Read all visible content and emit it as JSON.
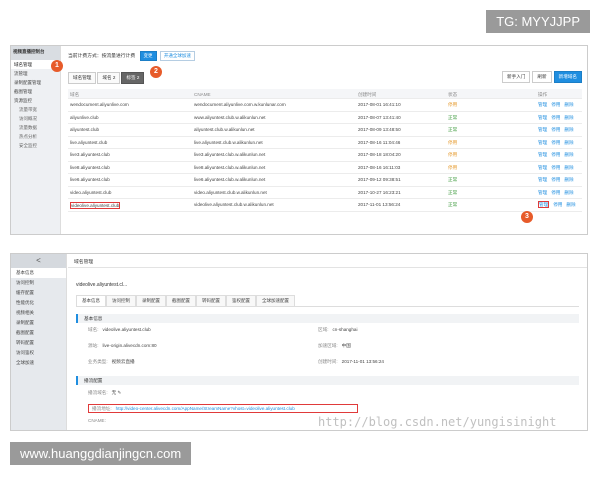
{
  "watermarks": {
    "top": "TG: MYYJJPP",
    "bottom": "www.huanggdianjingcn.com",
    "diagonal": "http://blog.csdn.net/yungisinight"
  },
  "panel1": {
    "sidebar": {
      "title": "视频直播控制台",
      "items": [
        "域名管理",
        "流管理",
        "录制配置管理",
        "截图管理",
        "资源监控",
        "流量带宽",
        "访问概况",
        "流量数据",
        "热点分析",
        "安全监控"
      ]
    },
    "notice": {
      "text": "当前计费方式：按流量进行计费",
      "change_label": "变更",
      "activate_label": "开通全球加速"
    },
    "tabs": [
      "域名管理",
      "域名 2",
      "标签 2"
    ],
    "actions": {
      "guide": "新手入门",
      "refresh": "刷新",
      "add": "新增域名"
    },
    "columns": [
      "域名",
      "CNAME",
      "创建时间",
      "状态",
      "操作"
    ],
    "rows": [
      {
        "domain": "wendocument.aliyunlive.com",
        "cname": "wendocument.aliyunlive.com.w.kunlunar.com",
        "created": "2017-08-01 16:41:10",
        "status": "停用",
        "status_type": "warn",
        "ops": [
          "管理",
          "停用",
          "删除"
        ]
      },
      {
        "domain": "aliyunlive.club",
        "cname": "www.aliyuntest.club.w.alikunlun.net",
        "created": "2017-08-07 13:41:40",
        "status": "正常",
        "status_type": "ok",
        "ops": [
          "管理",
          "停用",
          "删除"
        ]
      },
      {
        "domain": "aliyuntest.club",
        "cname": "aliyuntest.club.w.alikunlun.net",
        "created": "2017-08-09 13:48:50",
        "status": "正常",
        "status_type": "ok",
        "ops": [
          "管理",
          "停用",
          "删除"
        ]
      },
      {
        "domain": "live.aliyuntest.club",
        "cname": "live.aliyuntest.club.w.alikunlun.net",
        "created": "2017-08-16 11:04:46",
        "status": "停用",
        "status_type": "warn",
        "ops": [
          "管理",
          "停用",
          "删除"
        ]
      },
      {
        "domain": "live3.aliyuntest.club",
        "cname": "live3.aliyuntest.club.w.alikunlun.net",
        "created": "2017-08-18 18:04:20",
        "status": "停用",
        "status_type": "warn",
        "ops": [
          "管理",
          "停用",
          "删除"
        ]
      },
      {
        "domain": "live8.aliyuntest.club",
        "cname": "live8.aliyuntest.club.w.alikunlun.net",
        "created": "2017-08-16 16:11:03",
        "status": "停用",
        "status_type": "warn",
        "ops": [
          "管理",
          "停用",
          "删除"
        ]
      },
      {
        "domain": "live6.aliyuntest.club",
        "cname": "live6.aliyuntest.club.w.alikunlun.net",
        "created": "2017-09-12 09:38:51",
        "status": "正常",
        "status_type": "ok",
        "ops": [
          "管理",
          "停用",
          "删除"
        ]
      },
      {
        "domain": "video.aliyuntest.club",
        "cname": "video.aliyuntest.club.w.alikunlun.net",
        "created": "2017-10-27 16:23:21",
        "status": "正常",
        "status_type": "ok",
        "ops": [
          "管理",
          "停用",
          "删除"
        ]
      },
      {
        "domain": "videolive.aliyuntest.club",
        "cname": "videolive.aliyuntest.club.w.alikunlun.net",
        "created": "2017-11-01 13:56:24",
        "status": "正常",
        "status_type": "ok",
        "ops": [
          "管理",
          "停用",
          "删除"
        ]
      }
    ],
    "markers": [
      "1",
      "2",
      "3"
    ]
  },
  "panel2": {
    "sidebar": {
      "back": "<",
      "items": [
        "基本信息",
        "访问控制",
        "缓存配置",
        "性能优化",
        "视频相关",
        "录制配置",
        "截图配置",
        "转码配置",
        "访问鉴权",
        "全球加速"
      ]
    },
    "header": "域名管理",
    "domain": "videolive.aliyuntest.cl...",
    "tabs": [
      "基本信息",
      "访问控制",
      "录制配置",
      "截图配置",
      "转码配置",
      "鉴权配置",
      "全球加速配置"
    ],
    "basic_section": "基本信息",
    "fields": {
      "domain_label": "域名:",
      "domain_value": "videolive.aliyuntest.club",
      "region_label": "区域:",
      "region_value": "cn-shanghai",
      "origin_label": "源站:",
      "origin_value": "live-origin.alivecdn.com:80",
      "accel_label": "加速区域:",
      "accel_value": "中国",
      "type_label": "业务类型:",
      "type_value": "视频云直播",
      "created_label": "创建时间:",
      "created_value": "2017-11-01 13:56:24"
    },
    "play_section": "播流配置",
    "play_domain_label": "播流域名:",
    "play_domain_value": "无",
    "play_url_label": "播流地址:",
    "play_url_value": "http://video-center.alivecdn.com/AppName/StreamName?vhost=videolive.aliyuntest.club",
    "cname_label": "CNAME:"
  }
}
